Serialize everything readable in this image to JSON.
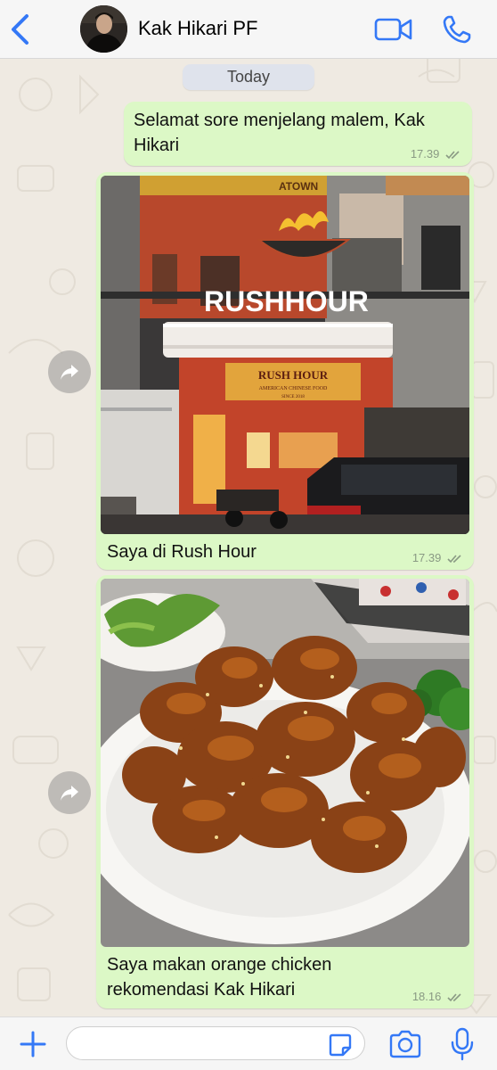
{
  "header": {
    "contact_name": "Kak Hikari PF",
    "back_icon": "chevron-left-icon",
    "video_icon": "video-camera-icon",
    "phone_icon": "phone-icon"
  },
  "chat": {
    "date_separator": "Today",
    "messages": [
      {
        "type": "text",
        "direction": "outgoing",
        "text": "Selamat sore menjelang malem, Kak Hikari",
        "time": "17.39",
        "status": "read"
      },
      {
        "type": "image",
        "direction": "outgoing",
        "image": "photo of Rush Hour restaurant storefront at dusk",
        "sign_text": "RUSHHOUR",
        "board_text": "RUSH HOUR",
        "board_subtext": "AMERICAN CHINESE FOOD",
        "board_since": "SINCE 2018",
        "top_sign": "ATOWN",
        "caption": "Saya di Rush Hour",
        "time": "17.39",
        "status": "read"
      },
      {
        "type": "image",
        "direction": "outgoing",
        "image": "photo of orange chicken on a white plate",
        "caption": "Saya makan orange chicken rekomendasi Kak Hikari",
        "time": "18.16",
        "status": "read"
      }
    ]
  },
  "input": {
    "value": "",
    "placeholder": "",
    "plus_icon": "plus-icon",
    "sticker_icon": "sticker-icon",
    "camera_icon": "camera-icon",
    "mic_icon": "microphone-icon"
  },
  "colors": {
    "accent": "#3478f6",
    "bubble": "#dcf8c6",
    "chat_background": "#efeae2"
  }
}
